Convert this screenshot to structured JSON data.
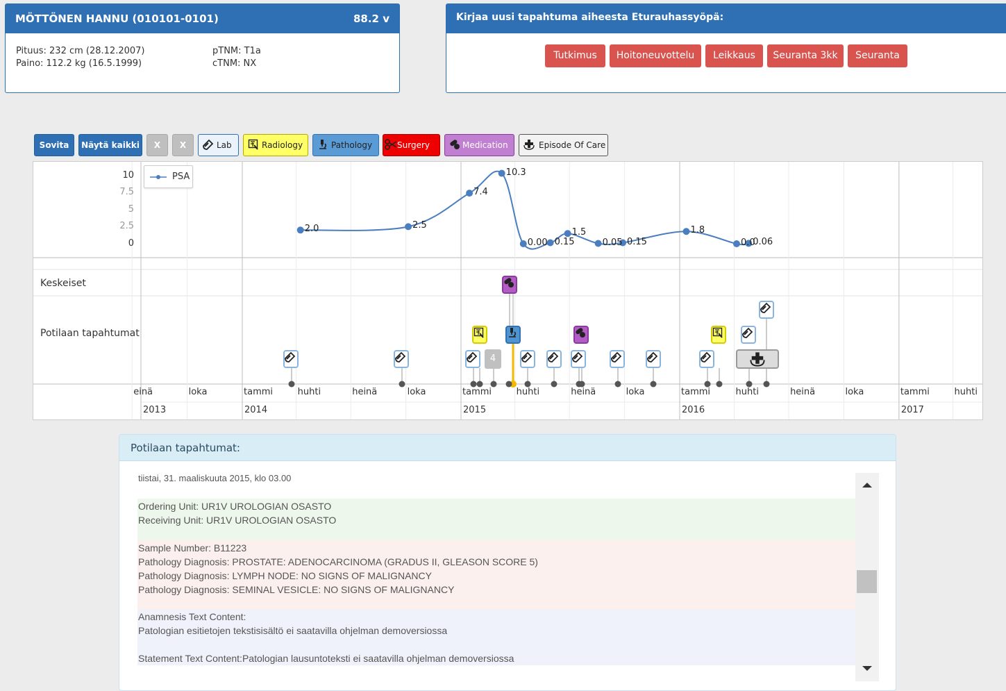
{
  "patient": {
    "name": "MÖTTÖNEN HANNU (010101-0101)",
    "age": "88.2 v",
    "height": "Pituus: 232 cm (28.12.2007)",
    "weight": "Paino: 112.2 kg (16.5.1999)",
    "ptnm": "pTNM: T1a",
    "ctnm": "cTNM: NX"
  },
  "new_event": {
    "title": "Kirjaa uusi tapahtuma aiheesta Eturauhassyöpä:",
    "buttons": [
      "Tutkimus",
      "Hoitoneuvottelu",
      "Leikkaus",
      "Seuranta 3kk",
      "Seuranta"
    ]
  },
  "toolbar": {
    "fit": "Sovita",
    "show_all": "Näytä kaikki",
    "x1": "X",
    "x2": "X",
    "lab": "Lab",
    "radiology": "Radiology",
    "pathology": "Pathology",
    "surgery": "Surgery",
    "medication": "Medication",
    "episode": "Episode Of Care"
  },
  "colors": {
    "header_blue": "#2f70b5",
    "red_button": "#d9534f",
    "radiology": "#ffff66",
    "pathology": "#4d94d0",
    "surgery": "#ee0000",
    "medication": "#b35cc5",
    "psa_line": "#4a7ebf",
    "highlight": "#f5b800"
  },
  "timeline": {
    "rows": {
      "central": "Keskeiset",
      "events": "Potilaan tapahtumat"
    },
    "legend": "PSA",
    "months": [
      "einä",
      "loka",
      "tammi",
      "huhti",
      "heinä",
      "loka",
      "tammi",
      "huhti",
      "heinä",
      "loka",
      "tammi",
      "huhti",
      "heinä",
      "loka",
      "tammi",
      "huhti"
    ],
    "years": [
      "2013",
      "2014",
      "2015",
      "2016",
      "2017"
    ],
    "event_count": "4"
  },
  "chart_data": {
    "type": "line",
    "series": [
      {
        "name": "PSA",
        "points": [
          {
            "date": "2014-04-08",
            "value": 2.0,
            "label": "2.0"
          },
          {
            "date": "2014-10-05",
            "value": 2.5,
            "label": "2.5"
          },
          {
            "date": "2015-01-15",
            "value": 7.4,
            "label": "7.4"
          },
          {
            "date": "2015-03-10",
            "value": 10.3,
            "label": "10.3"
          },
          {
            "date": "2015-04-15",
            "value": 0.0,
            "label": "0.00"
          },
          {
            "date": "2015-05-30",
            "value": 0.15,
            "label": "0.15"
          },
          {
            "date": "2015-06-28",
            "value": 1.5,
            "label": "1.5"
          },
          {
            "date": "2015-08-18",
            "value": 0.05,
            "label": "0.05"
          },
          {
            "date": "2015-09-28",
            "value": 0.15,
            "label": "0.15"
          },
          {
            "date": "2016-01-12",
            "value": 1.8,
            "label": "1.8"
          },
          {
            "date": "2016-04-05",
            "value": 0.0,
            "label": "0.0"
          },
          {
            "date": "2016-04-25",
            "value": 0.06,
            "label": "0.06"
          }
        ]
      }
    ],
    "y_ticks": [
      "10",
      "7.5",
      "5",
      "2.5",
      "0"
    ],
    "ylim": [
      0,
      10
    ],
    "xlim": [
      "2013-06",
      "2017-05"
    ]
  },
  "events_panel": {
    "title": "Potilaan tapahtumat:",
    "date": "tiistai, 31. maaliskuuta 2015, klo 03.00",
    "ordering_unit": "Ordering Unit: UR1V UROLOGIAN OSASTO",
    "receiving_unit": "Receiving Unit: UR1V UROLOGIAN OSASTO",
    "sample_number": "Sample Number: B11223",
    "diagnosis_1": "Pathology Diagnosis: PROSTATE: ADENOCARCINOMA (GRADUS II, GLEASON SCORE 5)",
    "diagnosis_2": "Pathology Diagnosis: LYMPH NODE: NO SIGNS OF MALIGNANCY",
    "diagnosis_3": "Pathology Diagnosis: SEMINAL VESICLE: NO SIGNS OF MALIGNANCY",
    "anamnesis_title": "Anamnesis Text Content:",
    "anamnesis": "Patologian esitietojen tekstisisältö ei saatavilla ohjelman demoversiossa",
    "statement": "Statement Text Content:Patologian lausuntoteksti ei saatavilla ohjelman demoversiossa"
  }
}
